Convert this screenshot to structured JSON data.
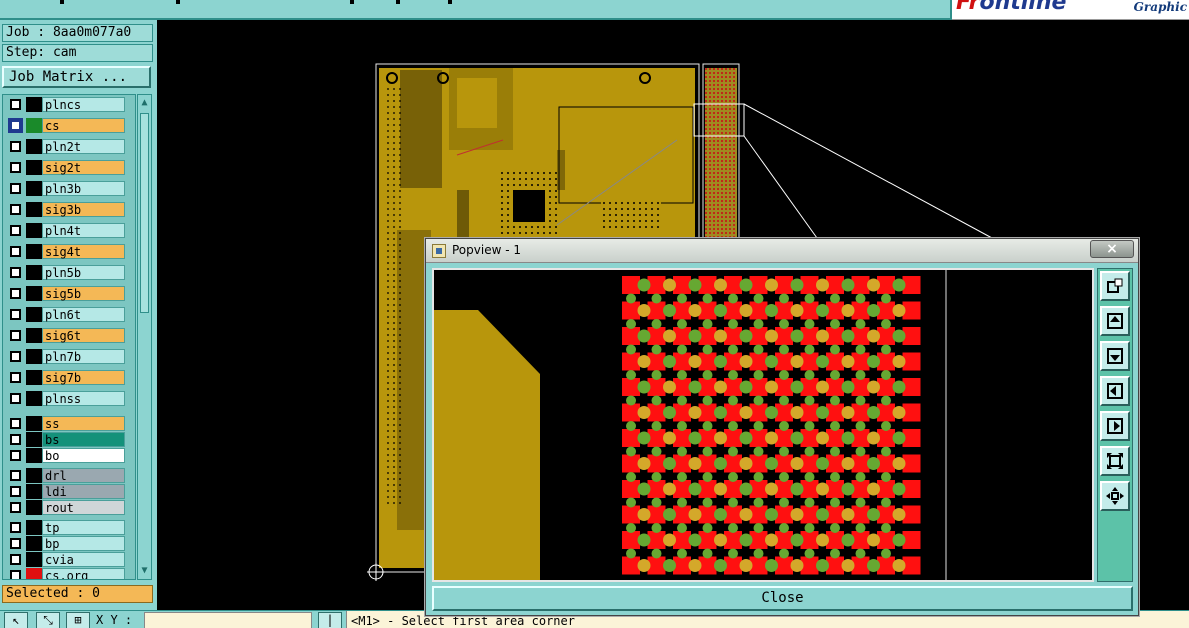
{
  "job": {
    "text": "Job : 8aa0m077a0"
  },
  "step": {
    "text": "Step: cam"
  },
  "job_matrix_button": "Job Matrix ...",
  "brand": {
    "logo_part1": "Fr",
    "logo_part2": "ontline",
    "subtitle": "Graphic"
  },
  "layers": [
    {
      "name": "plncs",
      "swatch": "#000000",
      "name_bg": "#b5e8e6"
    },
    {
      "name": "cs",
      "swatch": "#1a8a2a",
      "name_bg": "#f4b856",
      "active": true
    },
    {
      "name": "pln2t",
      "swatch": "#000000",
      "name_bg": "#b5e8e6"
    },
    {
      "name": "sig2t",
      "swatch": "#000000",
      "name_bg": "#f4b856"
    },
    {
      "name": "pln3b",
      "swatch": "#000000",
      "name_bg": "#b5e8e6"
    },
    {
      "name": "sig3b",
      "swatch": "#000000",
      "name_bg": "#f4b856"
    },
    {
      "name": "pln4t",
      "swatch": "#000000",
      "name_bg": "#b5e8e6"
    },
    {
      "name": "sig4t",
      "swatch": "#000000",
      "name_bg": "#f4b856"
    },
    {
      "name": "pln5b",
      "swatch": "#000000",
      "name_bg": "#b5e8e6"
    },
    {
      "name": "sig5b",
      "swatch": "#000000",
      "name_bg": "#f4b856"
    },
    {
      "name": "pln6t",
      "swatch": "#000000",
      "name_bg": "#b5e8e6"
    },
    {
      "name": "sig6t",
      "swatch": "#000000",
      "name_bg": "#f4b856"
    },
    {
      "name": "pln7b",
      "swatch": "#000000",
      "name_bg": "#b5e8e6"
    },
    {
      "name": "sig7b",
      "swatch": "#000000",
      "name_bg": "#f4b856"
    },
    {
      "name": "plnss",
      "swatch": "#000000",
      "name_bg": "#b5e8e6"
    },
    {
      "name": "ss",
      "swatch": "#000000",
      "name_bg": "#f4b856"
    },
    {
      "name": "bs",
      "swatch": "#000000",
      "name_bg": "#14917a"
    },
    {
      "name": "bo",
      "swatch": "#000000",
      "name_bg": "#ffffff"
    },
    {
      "name": "drl",
      "swatch": "#000000",
      "name_bg": "#9aa8b0"
    },
    {
      "name": "ldi",
      "swatch": "#000000",
      "name_bg": "#9aa8b0"
    },
    {
      "name": "rout",
      "swatch": "#000000",
      "name_bg": "#cfd6d8"
    },
    {
      "name": "tp",
      "swatch": "#000000",
      "name_bg": "#b5e8e6"
    },
    {
      "name": "bp",
      "swatch": "#000000",
      "name_bg": "#b5e8e6"
    },
    {
      "name": "cvia",
      "swatch": "#000000",
      "name_bg": "#b5e8e6"
    },
    {
      "name": "cs.org",
      "swatch": "#e01010",
      "name_bg": "#b5e8e6"
    }
  ],
  "selected": {
    "text": "Selected : 0"
  },
  "xy_label": "X Y :",
  "status": {
    "text": "<M1> - Select first area corner"
  },
  "popview": {
    "title": "Popview - 1",
    "close_x": "×",
    "close_button": "Close"
  },
  "colors": {
    "panel": "#8cd4d0",
    "copper": "#b8960c",
    "pad_red": "#ff1010",
    "pad_green": "#66a832",
    "pad_gold": "#d4a82a"
  }
}
